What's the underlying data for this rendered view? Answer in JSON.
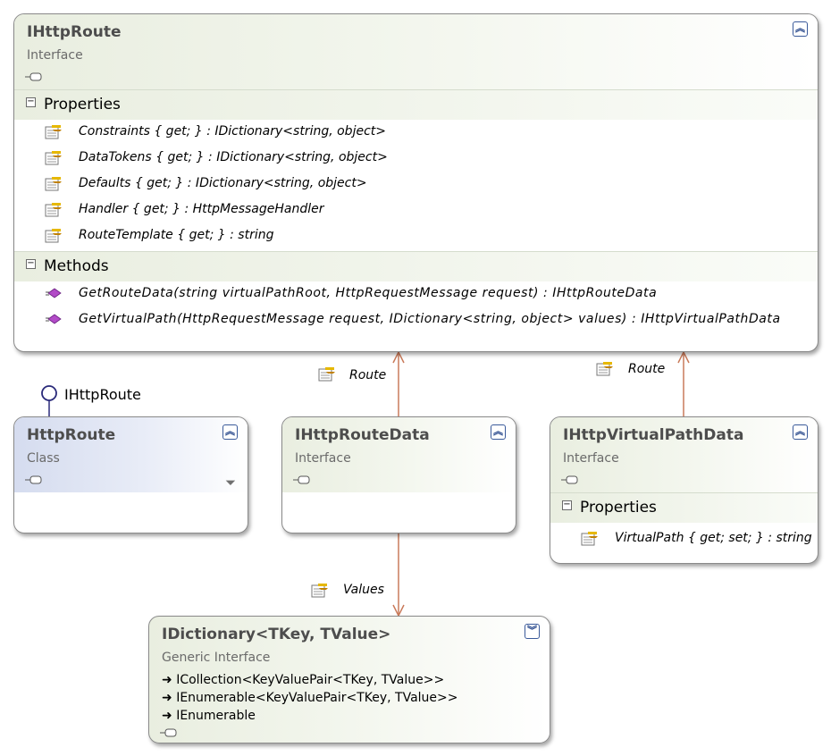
{
  "ihttproute": {
    "title": "IHttpRoute",
    "kind": "Interface",
    "properties_label": "Properties",
    "properties": [
      "Constraints { get; } : IDictionary<string, object>",
      "DataTokens { get; } : IDictionary<string, object>",
      "Defaults { get; } : IDictionary<string, object>",
      "Handler { get; } : HttpMessageHandler",
      "RouteTemplate { get; } : string"
    ],
    "methods_label": "Methods",
    "methods": [
      "GetRouteData(string virtualPathRoot, HttpRequestMessage request) : IHttpRouteData",
      "GetVirtualPath(HttpRequestMessage request, IDictionary<string, object> values) : IHttpVirtualPathData"
    ]
  },
  "httproute": {
    "title": "HttpRoute",
    "kind": "Class",
    "lollipop": "IHttpRoute"
  },
  "ihttproutedata": {
    "title": "IHttpRouteData",
    "kind": "Interface"
  },
  "ihttpvirtualpathdata": {
    "title": "IHttpVirtualPathData",
    "kind": "Interface",
    "properties_label": "Properties",
    "properties": [
      "VirtualPath { get; set; } : string"
    ]
  },
  "idictionary": {
    "title": "IDictionary<TKey, TValue>",
    "kind": "Generic Interface",
    "inherits": [
      "ICollection<KeyValuePair<TKey, TValue>>",
      "IEnumerable<KeyValuePair<TKey, TValue>>",
      "IEnumerable"
    ]
  },
  "associations": {
    "route_1": "Route",
    "route_2": "Route",
    "values": "Values"
  },
  "colors": {
    "arrow": "#c97a5a",
    "lollipop": "#2a2a7a",
    "interface_header": "#e9eee0",
    "class_header": "#d5dcef"
  }
}
